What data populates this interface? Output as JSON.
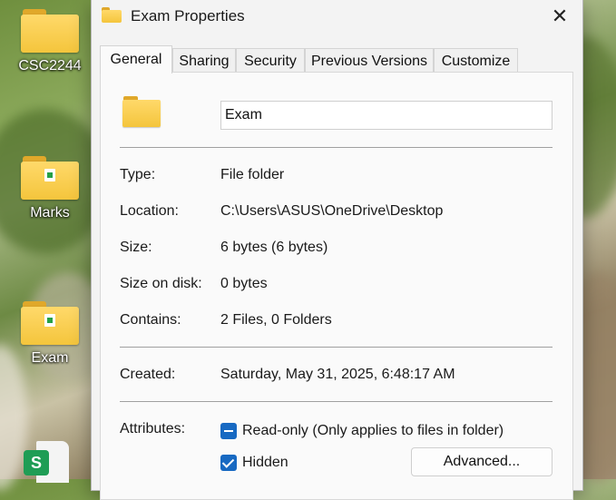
{
  "desktop": {
    "icons": [
      {
        "label": "CSC2244"
      },
      {
        "label": "Marks"
      },
      {
        "label": "Exam"
      }
    ],
    "excel_badge": "S"
  },
  "dialog": {
    "title": "Exam Properties",
    "close_symbol": "✕",
    "tabs": [
      {
        "label": "General",
        "active": true
      },
      {
        "label": "Sharing"
      },
      {
        "label": "Security"
      },
      {
        "label": "Previous Versions"
      },
      {
        "label": "Customize"
      }
    ],
    "general": {
      "name_value": "Exam",
      "rows": [
        {
          "label": "Type:",
          "value": "File folder"
        },
        {
          "label": "Location:",
          "value": "C:\\Users\\ASUS\\OneDrive\\Desktop"
        },
        {
          "label": "Size:",
          "value": "6 bytes (6 bytes)"
        },
        {
          "label": "Size on disk:",
          "value": "0 bytes"
        },
        {
          "label": "Contains:",
          "value": "2 Files, 0 Folders"
        }
      ],
      "created_label": "Created:",
      "created_value": "Saturday, May 31, 2025, 6:48:17 AM",
      "attributes_label": "Attributes:",
      "readonly_label": "Read-only (Only applies to files in folder)",
      "readonly_state": "indeterminate",
      "hidden_label": "Hidden",
      "hidden_state": "checked",
      "advanced_label": "Advanced..."
    }
  },
  "colors": {
    "accent": "#1769c2",
    "folder": "#f4c53c",
    "excel": "#1f9d55"
  }
}
